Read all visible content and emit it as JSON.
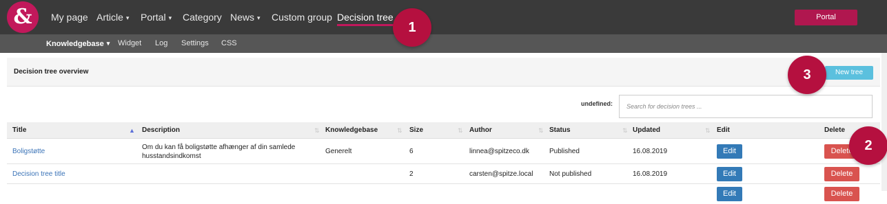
{
  "nav": {
    "logo": "&",
    "items": [
      {
        "label": "My page",
        "caret": ""
      },
      {
        "label": "Article",
        "caret": "▾"
      },
      {
        "label": "Portal",
        "caret": "▾"
      },
      {
        "label": "Category",
        "caret": ""
      },
      {
        "label": "News",
        "caret": "▾"
      },
      {
        "label": "Custom group",
        "caret": ""
      },
      {
        "label": "Decision tree",
        "caret": ""
      }
    ],
    "portal_button": "Portal"
  },
  "subnav": {
    "items": [
      {
        "label": "Knowledgebase",
        "caret": "▾"
      },
      {
        "label": "Widget",
        "caret": ""
      },
      {
        "label": "Log",
        "caret": ""
      },
      {
        "label": "Settings",
        "caret": ""
      },
      {
        "label": "CSS",
        "caret": ""
      }
    ]
  },
  "badges": [
    "1",
    "2",
    "3"
  ],
  "panel": {
    "title": "Decision tree overview",
    "new_button": "New tree"
  },
  "search": {
    "label": "undefined:",
    "placeholder": "Search for decision trees ...",
    "value": ""
  },
  "table": {
    "columns": [
      "Title",
      "Description",
      "Knowledgebase",
      "Size",
      "Author",
      "Status",
      "Updated",
      "Edit",
      "Delete"
    ],
    "sort_arrow": "▲",
    "sort_idle": "⇅",
    "rows": [
      {
        "title": "Boligstøtte",
        "description": "Om du kan få boligstøtte afhænger af din samlede husstandsindkomst",
        "knowledgebase": "Generelt",
        "size": "6",
        "author": "linnea@spitzeco.dk",
        "status": "Published",
        "updated": "16.08.2019",
        "edit": "Edit",
        "delete": "Delete"
      },
      {
        "title": "Decision tree title",
        "description": "",
        "knowledgebase": "",
        "size": "2",
        "author": "carsten@spitze.local",
        "status": "Not published",
        "updated": "16.08.2019",
        "edit": "Edit",
        "delete": "Delete"
      },
      {
        "title": "",
        "description": "",
        "knowledgebase": "",
        "size": "",
        "author": "",
        "status": "",
        "updated": "",
        "edit": "Edit",
        "delete": "Delete"
      }
    ]
  },
  "colors": {
    "brand": "#c2185b",
    "edit": "#337ab7",
    "delete": "#d9534f",
    "new": "#5bc0de"
  }
}
